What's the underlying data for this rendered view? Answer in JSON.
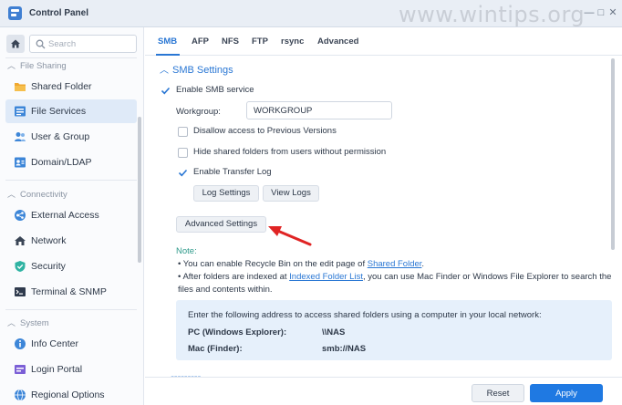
{
  "window": {
    "title": "Control Panel",
    "minimize_glyph": "—",
    "maximize_glyph": "□",
    "close_glyph": "✕",
    "watermark": "www.wintips.org",
    "icon": "control-panel-icon"
  },
  "sidebar": {
    "search_placeholder": "Search",
    "groups": [
      {
        "label": "File Sharing",
        "items": [
          {
            "label": "Shared Folder",
            "icon": "shared-folder-icon"
          },
          {
            "label": "File Services",
            "icon": "file-services-icon",
            "active": true
          }
        ]
      },
      {
        "label": "User & Group",
        "standalone": true,
        "icon": "user-group-icon"
      },
      {
        "label": "Domain/LDAP",
        "standalone": true,
        "icon": "domain-ldap-icon"
      }
    ],
    "file_sharing_label": "File Sharing",
    "shared_folder": "Shared Folder",
    "file_services": "File Services",
    "user_group": "User & Group",
    "domain_ldap": "Domain/LDAP",
    "connectivity_label": "Connectivity",
    "external_access": "External Access",
    "network": "Network",
    "security": "Security",
    "terminal_snmp": "Terminal & SNMP",
    "system_label": "System",
    "info_center": "Info Center",
    "login_portal": "Login Portal",
    "regional_options": "Regional Options"
  },
  "tabs": [
    "SMB",
    "AFP",
    "NFS",
    "FTP",
    "rsync",
    "Advanced"
  ],
  "smb": {
    "section_title": "SMB Settings",
    "enable_smb": "Enable SMB service",
    "workgroup_label": "Workgroup:",
    "workgroup_value": "WORKGROUP",
    "disallow_prev": "Disallow access to Previous Versions",
    "hide_shared": "Hide shared folders from users without permission",
    "enable_transfer_log": "Enable Transfer Log",
    "log_settings": "Log Settings",
    "view_logs": "View Logs",
    "advanced_settings": "Advanced Settings",
    "note_title": "Note:",
    "bullet1_pre": "You can enable Recycle Bin on the edit page of",
    "bullet1_link": "Shared Folder",
    "bullet1_post": ".",
    "bullet2_pre": "After folders are indexed at",
    "bullet2_link": "Indexed Folder List",
    "bullet2_post": ", you can use Mac Finder or Windows File Explorer to search the files and contents within.",
    "info_intro": "Enter the following address to access shared folders using a computer in your local network:",
    "pc_label": "PC (Windows Explorer):",
    "pc_value": "\\\\NAS",
    "mac_label": "Mac (Finder):",
    "mac_value": "smb://NAS"
  },
  "footer": {
    "reset": "Reset",
    "apply": "Apply"
  },
  "colors": {
    "accent": "#2a77d4",
    "apply": "#1f79e2",
    "note": "#2f9a8b",
    "arrow": "#e02424"
  }
}
